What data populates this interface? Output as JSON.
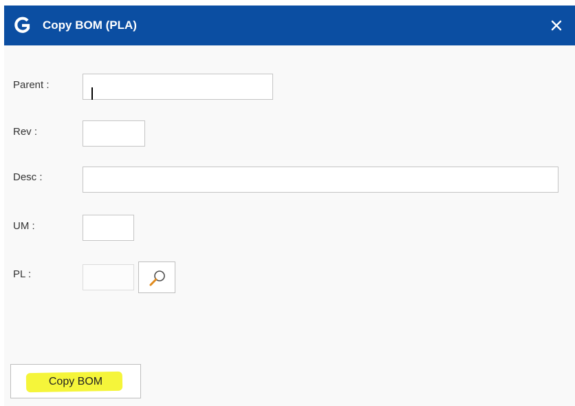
{
  "dialog": {
    "title": "Copy BOM (PLA)",
    "logo_icon": "g-logo-icon",
    "close_icon": "close-icon",
    "colors": {
      "titlebar": "#0b4ea2",
      "highlight": "#f5f53a"
    }
  },
  "form": {
    "parent": {
      "label": "Parent :",
      "value": ""
    },
    "rev": {
      "label": "Rev :",
      "value": ""
    },
    "desc": {
      "label": "Desc :",
      "value": ""
    },
    "um": {
      "label": "UM :",
      "value": ""
    },
    "pl": {
      "label": "PL :",
      "value": "",
      "lookup_icon": "search-icon"
    }
  },
  "actions": {
    "copy_bom_label": "Copy BOM"
  }
}
